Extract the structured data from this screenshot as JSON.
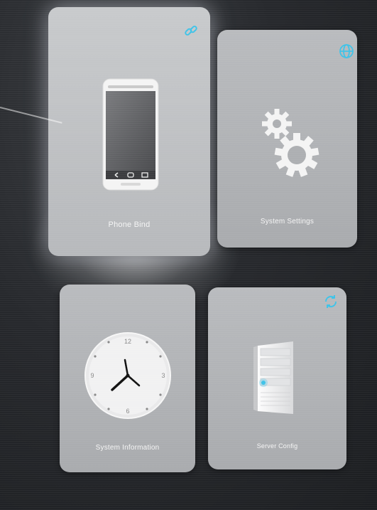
{
  "tiles": {
    "phone_bind": {
      "label": "Phone Bind",
      "corner_icon": "link-icon"
    },
    "system_settings": {
      "label": "System Settings",
      "corner_icon": "globe-icon"
    },
    "system_information": {
      "label": "System Information",
      "clock_numbers": [
        "12",
        "3",
        "6",
        "9"
      ]
    },
    "server_config": {
      "label": "Server Config",
      "corner_icon": "refresh-icon"
    }
  },
  "colors": {
    "accent": "#3fc3e8",
    "tile_bg": "#b3b5b8",
    "screen_bg": "#26282c"
  }
}
